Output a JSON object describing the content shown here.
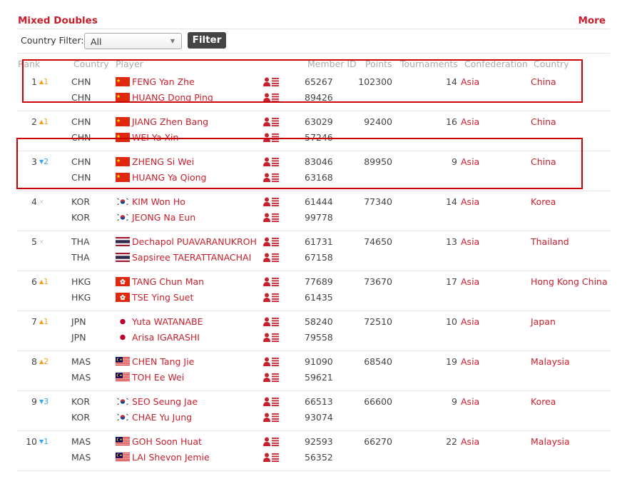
{
  "panel": {
    "title": "Mixed Doubles",
    "more_label": "More"
  },
  "filter": {
    "label": "Country Filter:",
    "selected": "All",
    "button_label": "Filter"
  },
  "columns": [
    "Rank",
    "Country",
    "Player",
    "Member ID",
    "Points",
    "Tournaments",
    "Confederation",
    "Country"
  ],
  "rows": [
    {
      "rank": "1",
      "change": {
        "dir": "up",
        "amount": "1"
      },
      "points": "102300",
      "tournaments": "14",
      "confederation": "Asia",
      "country_name": "China",
      "players": [
        {
          "country": "CHN",
          "flag": "chn",
          "name": "FENG Yan Zhe",
          "member_id": "65267"
        },
        {
          "country": "CHN",
          "flag": "chn",
          "name": "HUANG Dong Ping",
          "member_id": "89426"
        }
      ]
    },
    {
      "rank": "2",
      "change": {
        "dir": "up",
        "amount": "1"
      },
      "points": "92400",
      "tournaments": "16",
      "confederation": "Asia",
      "country_name": "China",
      "players": [
        {
          "country": "CHN",
          "flag": "chn",
          "name": "JIANG Zhen Bang",
          "member_id": "63029"
        },
        {
          "country": "CHN",
          "flag": "chn",
          "name": "WEI Ya Xin",
          "member_id": "57246"
        }
      ]
    },
    {
      "rank": "3",
      "change": {
        "dir": "down",
        "amount": "2"
      },
      "points": "89950",
      "tournaments": "9",
      "confederation": "Asia",
      "country_name": "China",
      "players": [
        {
          "country": "CHN",
          "flag": "chn",
          "name": "ZHENG Si Wei",
          "member_id": "83046"
        },
        {
          "country": "CHN",
          "flag": "chn",
          "name": "HUANG Ya Qiong",
          "member_id": "63168"
        }
      ]
    },
    {
      "rank": "4",
      "change": {
        "dir": "same",
        "amount": ""
      },
      "points": "77340",
      "tournaments": "14",
      "confederation": "Asia",
      "country_name": "Korea",
      "players": [
        {
          "country": "KOR",
          "flag": "kor",
          "name": "KIM Won Ho",
          "member_id": "61444"
        },
        {
          "country": "KOR",
          "flag": "kor",
          "name": "JEONG Na Eun",
          "member_id": "99778"
        }
      ]
    },
    {
      "rank": "5",
      "change": {
        "dir": "same",
        "amount": ""
      },
      "points": "74650",
      "tournaments": "13",
      "confederation": "Asia",
      "country_name": "Thailand",
      "players": [
        {
          "country": "THA",
          "flag": "tha",
          "name": "Dechapol PUAVARANUKROH",
          "member_id": "61731"
        },
        {
          "country": "THA",
          "flag": "tha",
          "name": "Sapsiree TAERATTANACHAI",
          "member_id": "67158"
        }
      ]
    },
    {
      "rank": "6",
      "change": {
        "dir": "up",
        "amount": "1"
      },
      "points": "73670",
      "tournaments": "17",
      "confederation": "Asia",
      "country_name": "Hong Kong China",
      "players": [
        {
          "country": "HKG",
          "flag": "hkg",
          "name": "TANG Chun Man",
          "member_id": "77689"
        },
        {
          "country": "HKG",
          "flag": "hkg",
          "name": "TSE Ying Suet",
          "member_id": "61435"
        }
      ]
    },
    {
      "rank": "7",
      "change": {
        "dir": "up",
        "amount": "1"
      },
      "points": "72510",
      "tournaments": "10",
      "confederation": "Asia",
      "country_name": "Japan",
      "players": [
        {
          "country": "JPN",
          "flag": "jpn",
          "name": "Yuta WATANABE",
          "member_id": "58240"
        },
        {
          "country": "JPN",
          "flag": "jpn",
          "name": "Arisa IGARASHI",
          "member_id": "79558"
        }
      ]
    },
    {
      "rank": "8",
      "change": {
        "dir": "up",
        "amount": "2"
      },
      "points": "68540",
      "tournaments": "19",
      "confederation": "Asia",
      "country_name": "Malaysia",
      "players": [
        {
          "country": "MAS",
          "flag": "mas",
          "name": "CHEN Tang Jie",
          "member_id": "91090"
        },
        {
          "country": "MAS",
          "flag": "mas",
          "name": "TOH Ee Wei",
          "member_id": "59621"
        }
      ]
    },
    {
      "rank": "9",
      "change": {
        "dir": "down",
        "amount": "3"
      },
      "points": "66600",
      "tournaments": "9",
      "confederation": "Asia",
      "country_name": "Korea",
      "players": [
        {
          "country": "KOR",
          "flag": "kor",
          "name": "SEO Seung Jae",
          "member_id": "66513"
        },
        {
          "country": "KOR",
          "flag": "kor",
          "name": "CHAE Yu Jung",
          "member_id": "93074"
        }
      ]
    },
    {
      "rank": "10",
      "change": {
        "dir": "down",
        "amount": "1"
      },
      "points": "66270",
      "tournaments": "22",
      "confederation": "Asia",
      "country_name": "Malaysia",
      "players": [
        {
          "country": "MAS",
          "flag": "mas",
          "name": "GOH Soon Huat",
          "member_id": "92593"
        },
        {
          "country": "MAS",
          "flag": "mas",
          "name": "LAI Shevon Jemie",
          "member_id": "56352"
        }
      ]
    }
  ],
  "colors": {
    "accent": "#c8202c",
    "highlight_box": "#cc0000",
    "rank_up": "#f0a020",
    "rank_down": "#3aa6e0"
  },
  "icons": {
    "player_profile": "player-profile-icon",
    "rank_up": "triangle-up-icon",
    "rank_down": "triangle-down-icon",
    "rank_same": "dot-icon"
  }
}
